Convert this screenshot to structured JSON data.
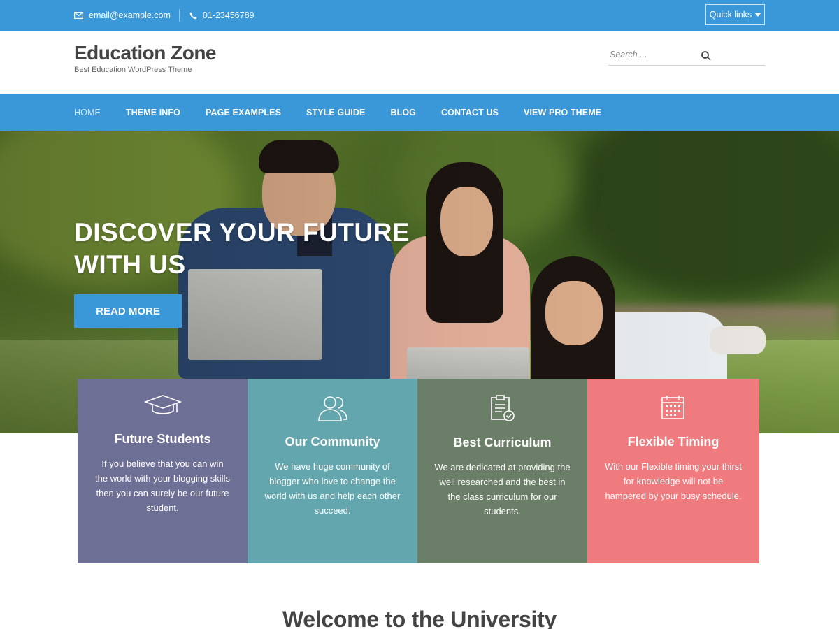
{
  "topbar": {
    "email": "email@example.com",
    "phone": "01-23456789",
    "quick_links": "Quick links",
    "email_icon": "envelope-icon",
    "phone_icon": "phone-icon",
    "caret_icon": "caret-down-icon"
  },
  "header": {
    "title": "Education Zone",
    "tagline": "Best Education WordPress Theme",
    "search_placeholder": "Search ...",
    "search_icon": "magnifier-icon"
  },
  "nav": {
    "items": [
      {
        "label": "HOME",
        "active": true
      },
      {
        "label": "THEME INFO"
      },
      {
        "label": "PAGE EXAMPLES"
      },
      {
        "label": "STYLE GUIDE"
      },
      {
        "label": "BLOG"
      },
      {
        "label": "CONTACT US"
      },
      {
        "label": "VIEW PRO THEME"
      }
    ]
  },
  "hero": {
    "title_line1": "DISCOVER YOUR FUTURE",
    "title_line2": "WITH US",
    "button": "READ MORE"
  },
  "features": [
    {
      "title": "Future Students",
      "text": "If you believe that you can win the world with your blogging skills then you can surely be our future student.",
      "icon": "graduation-cap-icon",
      "color": "#6e6f95"
    },
    {
      "title": "Our Community",
      "text": "We have huge community of blogger who love to change the world with us and help each other succeed.",
      "icon": "users-icon",
      "color": "#63a6ad"
    },
    {
      "title": "Best Curriculum",
      "text": "We are dedicated at providing the well researched and the best in the class curriculum for our students.",
      "icon": "clipboard-check-icon",
      "color": "#6b7e67"
    },
    {
      "title": "Flexible Timing",
      "text": "With our Flexible timing your thirst for knowledge will not be hampered by your busy schedule.",
      "icon": "calendar-icon",
      "color": "#f07b7e"
    }
  ],
  "welcome": {
    "heading": "Welcome to the University"
  },
  "colors": {
    "accent": "#3a98d8"
  }
}
